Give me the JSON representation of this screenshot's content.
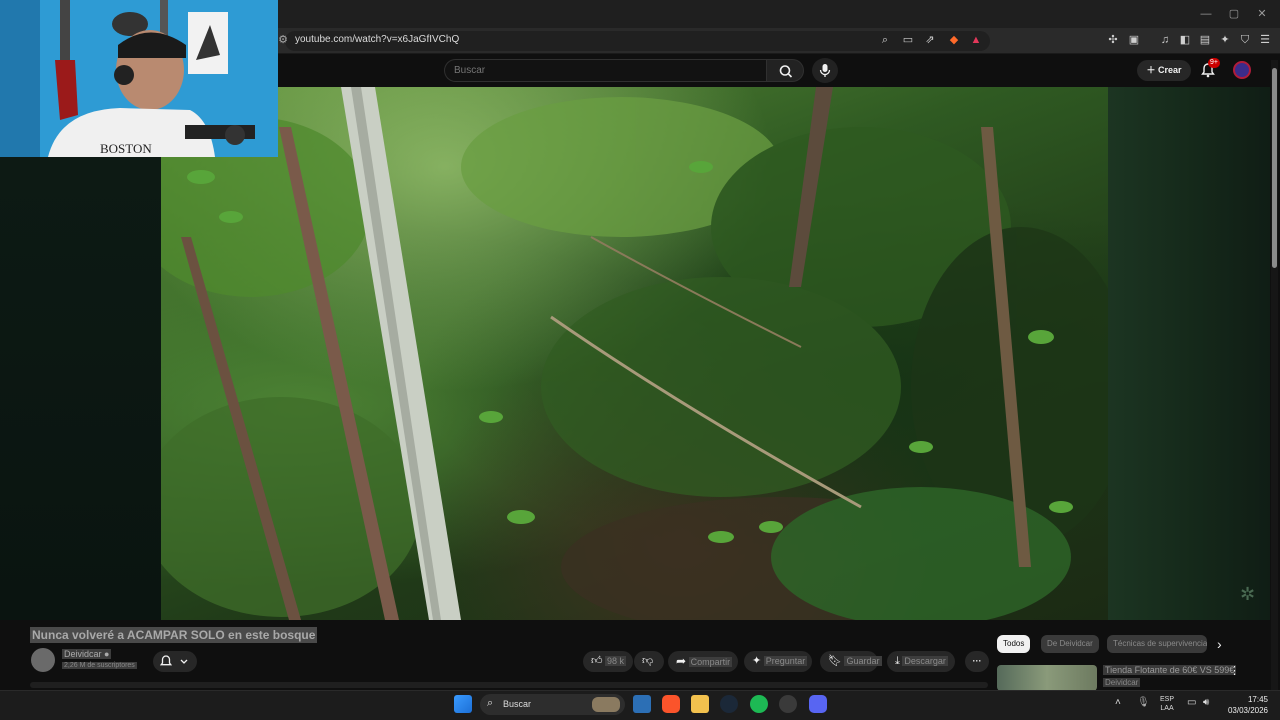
{
  "browser": {
    "url": "youtube.com/watch?v=x6JaGfIVChQ"
  },
  "youtube": {
    "search_placeholder": "Buscar",
    "create_label": "Crear",
    "notifications_badge": "9+"
  },
  "video": {
    "title": "Nunca volveré a ACAMPAR SOLO en este bosque",
    "channel_name": "Deividcar",
    "subscribers": "2,26 M de suscriptores",
    "like_count": "98 k",
    "actions": {
      "share": "Compartir",
      "ask": "Preguntar",
      "save": "Guardar",
      "download": "Descargar"
    }
  },
  "webcam": {
    "shirt_text": "BOSTON"
  },
  "recommendations": {
    "chips": [
      "Todos",
      "De Deividcar",
      "Técnicas de supervivencia"
    ],
    "items": [
      {
        "title": "Tienda Flotante de 60€ VS 599€",
        "channel": "Deividcar"
      }
    ]
  },
  "taskbar": {
    "search_label": "Buscar",
    "lang_line1": "ESP",
    "lang_line2": "LAA",
    "time": "17:45",
    "date": "03/03/2026"
  }
}
